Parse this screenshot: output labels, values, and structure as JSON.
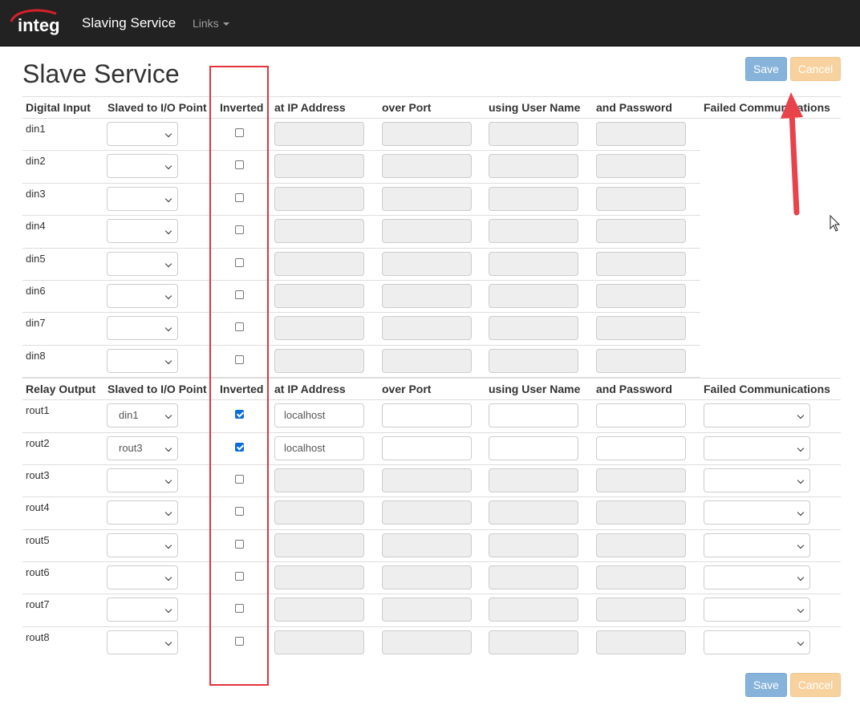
{
  "navbar": {
    "logo_text": "integ",
    "brand": "Slaving Service",
    "links_label": "Links"
  },
  "page_title": "Slave Service",
  "buttons": {
    "save": "Save",
    "cancel": "Cancel"
  },
  "digital_input": {
    "headers": [
      "Digital Input",
      "Slaved to I/O Point",
      "Inverted",
      "at IP Address",
      "over Port",
      "using User Name",
      "and Password",
      "Failed Communications"
    ],
    "rows": [
      {
        "name": "din1",
        "slaved": "",
        "inverted": false,
        "ip": "",
        "enabled": false
      },
      {
        "name": "din2",
        "slaved": "",
        "inverted": false,
        "ip": "",
        "enabled": false
      },
      {
        "name": "din3",
        "slaved": "",
        "inverted": false,
        "ip": "",
        "enabled": false
      },
      {
        "name": "din4",
        "slaved": "",
        "inverted": false,
        "ip": "",
        "enabled": false
      },
      {
        "name": "din5",
        "slaved": "",
        "inverted": false,
        "ip": "",
        "enabled": false
      },
      {
        "name": "din6",
        "slaved": "",
        "inverted": false,
        "ip": "",
        "enabled": false
      },
      {
        "name": "din7",
        "slaved": "",
        "inverted": false,
        "ip": "",
        "enabled": false
      },
      {
        "name": "din8",
        "slaved": "",
        "inverted": false,
        "ip": "",
        "enabled": false
      }
    ]
  },
  "relay_output": {
    "headers": [
      "Relay Output",
      "Slaved to I/O Point",
      "Inverted",
      "at IP Address",
      "over Port",
      "using User Name",
      "and Password",
      "Failed Communications"
    ],
    "rows": [
      {
        "name": "rout1",
        "slaved": "din1",
        "inverted": true,
        "ip": "localhost",
        "enabled": true
      },
      {
        "name": "rout2",
        "slaved": "rout3",
        "inverted": true,
        "ip": "localhost",
        "enabled": true
      },
      {
        "name": "rout3",
        "slaved": "",
        "inverted": false,
        "ip": "",
        "enabled": false
      },
      {
        "name": "rout4",
        "slaved": "",
        "inverted": false,
        "ip": "",
        "enabled": false
      },
      {
        "name": "rout5",
        "slaved": "",
        "inverted": false,
        "ip": "",
        "enabled": false
      },
      {
        "name": "rout6",
        "slaved": "",
        "inverted": false,
        "ip": "",
        "enabled": false
      },
      {
        "name": "rout7",
        "slaved": "",
        "inverted": false,
        "ip": "",
        "enabled": false
      },
      {
        "name": "rout8",
        "slaved": "",
        "inverted": false,
        "ip": "",
        "enabled": false
      }
    ]
  },
  "colors": {
    "navbar": "#222222",
    "save_button": "#87b3da",
    "cancel_button": "#f7d29e",
    "annotation": "#e0353b",
    "checkbox_checked": "#0b6cdc"
  },
  "icons": [
    "integ-logo",
    "chevron-down-icon",
    "caret-down-icon",
    "red-arrow-annotation",
    "mouse-cursor-icon"
  ]
}
